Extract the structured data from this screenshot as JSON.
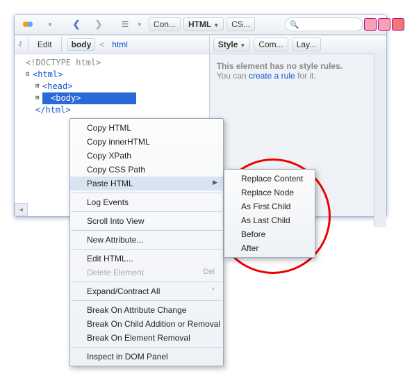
{
  "toolbar": {
    "tabs": {
      "console": "Con...",
      "html": "HTML",
      "css": "CS..."
    },
    "search_placeholder": ""
  },
  "breadcrumb": {
    "edit": "Edit",
    "body": "body",
    "html": "html"
  },
  "tree": {
    "doctype": "<!DOCTYPE html>",
    "html_open": "<html>",
    "head": "<head>",
    "body_sel": "<body>",
    "html_close": "</html>"
  },
  "side_tabs": {
    "style": "Style",
    "computed": "Com...",
    "layout": "Lay..."
  },
  "side_info": {
    "line1": "This element has no style rules.",
    "line2a": "You can ",
    "link": "create a rule",
    "line2b": " for it."
  },
  "context_menu": {
    "copy_html": "Copy HTML",
    "copy_inner": "Copy innerHTML",
    "copy_xpath": "Copy XPath",
    "copy_csspath": "Copy CSS Path",
    "paste_html": "Paste HTML",
    "log_events": "Log Events",
    "scroll_into_view": "Scroll Into View",
    "new_attribute": "New Attribute...",
    "edit_html": "Edit HTML...",
    "delete_element": "Delete Element",
    "delete_shortcut": "Del",
    "expand_contract": "Expand/Contract All",
    "expand_shortcut": "*",
    "break_attr": "Break On Attribute Change",
    "break_child": "Break On Child Addition or Removal",
    "break_remove": "Break On Element Removal",
    "inspect_dom": "Inspect in DOM Panel"
  },
  "submenu": {
    "replace_content": "Replace Content",
    "replace_node": "Replace Node",
    "first_child": "As First Child",
    "last_child": "As Last Child",
    "before": "Before",
    "after": "After"
  }
}
